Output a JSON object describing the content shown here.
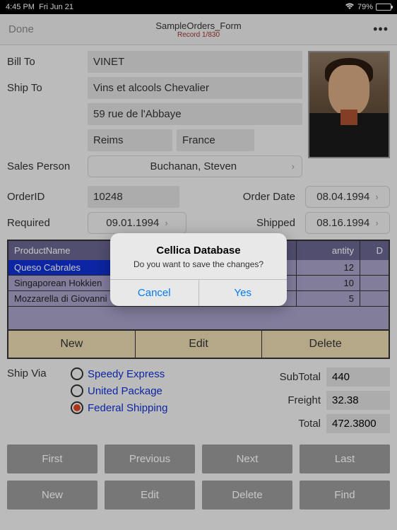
{
  "status": {
    "time": "4:45 PM",
    "date": "Fri Jun 21",
    "battery": "79%"
  },
  "nav": {
    "done": "Done",
    "title": "SampleOrders_Form",
    "subtitle": "Record 1/830",
    "more": "•••"
  },
  "labels": {
    "billTo": "Bill To",
    "shipTo": "Ship To",
    "salesPerson": "Sales Person",
    "orderId": "OrderID",
    "orderDate": "Order Date",
    "required": "Required",
    "shipped": "Shipped",
    "shipVia": "Ship Via",
    "subtotal": "SubTotal",
    "freight": "Freight",
    "total": "Total"
  },
  "fields": {
    "billTo": "VINET",
    "shipName": "Vins et alcools Chevalier",
    "shipAddr": "59 rue de l'Abbaye",
    "shipCity": "Reims",
    "shipCountry": "France",
    "salesPerson": "Buchanan, Steven",
    "orderId": "10248",
    "orderDate": "08.04.1994",
    "required": "09.01.1994",
    "shipped": "08.16.1994"
  },
  "table": {
    "headers": {
      "name": "ProductName",
      "qty": "antity",
      "end": "D"
    },
    "rows": [
      {
        "name": "Queso Cabrales",
        "qty": "12"
      },
      {
        "name": "Singaporean Hokkien",
        "qty": "10"
      },
      {
        "name": "Mozzarella di Giovanni",
        "qty": "5"
      }
    ],
    "actions": {
      "new": "New",
      "edit": "Edit",
      "delete": "Delete"
    }
  },
  "shipOptions": [
    "Speedy Express",
    "United Package",
    "Federal Shipping"
  ],
  "shipSelected": 2,
  "totals": {
    "subtotal": "440",
    "freight": "32.38",
    "total": "472.3800"
  },
  "navButtons": [
    "First",
    "Previous",
    "Next",
    "Last",
    "New",
    "Edit",
    "Delete",
    "Find"
  ],
  "alert": {
    "title": "Cellica Database",
    "message": "Do you want to save the changes?",
    "cancel": "Cancel",
    "yes": "Yes"
  }
}
